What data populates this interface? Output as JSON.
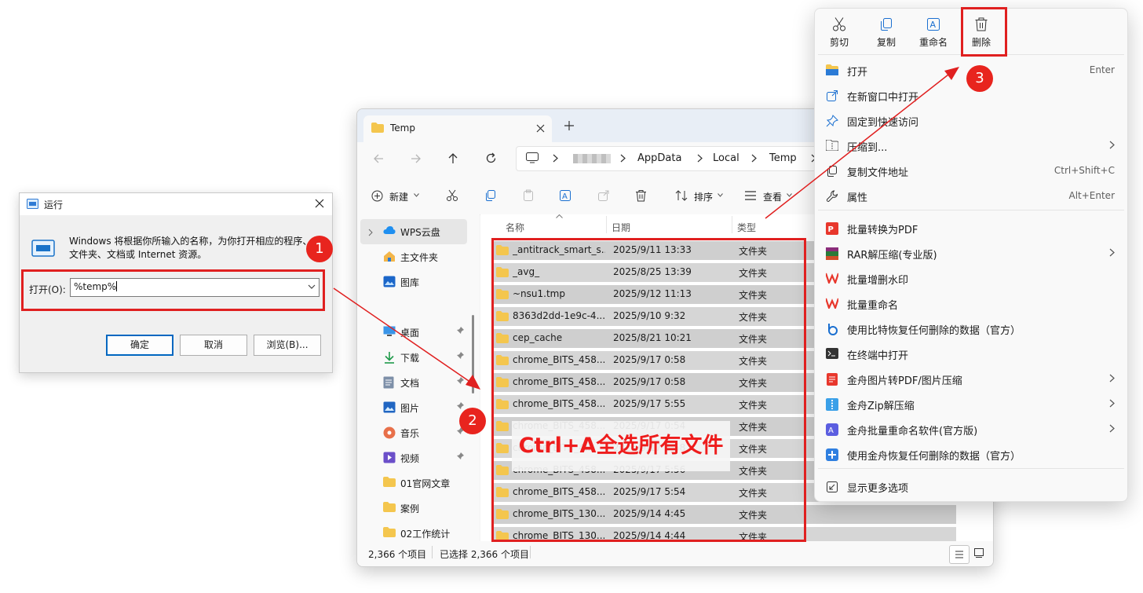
{
  "run_dialog": {
    "title": "运行",
    "description": "Windows 将根据你所输入的名称，为你打开相应的程序、文件夹、文档或 Internet 资源。",
    "open_label": "打开(O):",
    "input_value": "%temp%",
    "ok": "确定",
    "cancel": "取消",
    "browse": "浏览(B)..."
  },
  "explorer": {
    "tab_title": "Temp",
    "breadcrumb": [
      "AppData",
      "Local",
      "Temp"
    ],
    "toolbar": {
      "new": "新建",
      "sort": "排序",
      "view": "查看"
    },
    "nav": [
      {
        "label": "WPS云盘",
        "icon": "cloud-icon",
        "pinned": false
      },
      {
        "label": "主文件夹",
        "icon": "home-icon",
        "pinned": false
      },
      {
        "label": "图库",
        "icon": "gallery-icon",
        "pinned": false
      },
      {
        "label": "桌面",
        "icon": "desktop-icon",
        "pinned": true
      },
      {
        "label": "下载",
        "icon": "download-icon",
        "pinned": true
      },
      {
        "label": "文档",
        "icon": "document-icon",
        "pinned": true
      },
      {
        "label": "图片",
        "icon": "pictures-icon",
        "pinned": true
      },
      {
        "label": "音乐",
        "icon": "music-icon",
        "pinned": true
      },
      {
        "label": "视频",
        "icon": "video-icon",
        "pinned": true
      },
      {
        "label": "01官网文章",
        "icon": "folder-icon",
        "pinned": false
      },
      {
        "label": "案例",
        "icon": "folder-icon",
        "pinned": false
      },
      {
        "label": "02工作统计",
        "icon": "folder-icon",
        "pinned": false
      }
    ],
    "columns": {
      "name": "名称",
      "date": "日期",
      "type": "类型"
    },
    "files": [
      {
        "name": "_antitrack_smart_s...",
        "date": "2025/9/11 13:33",
        "type": "文件夹"
      },
      {
        "name": "_avg_",
        "date": "2025/8/25 13:39",
        "type": "文件夹"
      },
      {
        "name": "~nsu1.tmp",
        "date": "2025/9/12 11:13",
        "type": "文件夹"
      },
      {
        "name": "8363d2dd-1e9c-4...",
        "date": "2025/9/10 9:32",
        "type": "文件夹"
      },
      {
        "name": "cep_cache",
        "date": "2025/8/21 10:21",
        "type": "文件夹"
      },
      {
        "name": "chrome_BITS_458...",
        "date": "2025/9/17 0:58",
        "type": "文件夹"
      },
      {
        "name": "chrome_BITS_458...",
        "date": "2025/9/17 0:58",
        "type": "文件夹"
      },
      {
        "name": "chrome_BITS_458...",
        "date": "2025/9/17 5:55",
        "type": "文件夹"
      },
      {
        "name": "chrome_BITS_458...",
        "date": "2025/9/17 0:54",
        "type": "文件夹"
      },
      {
        "name": "chrome_BITS_4...",
        "date": "2025/9/17 5:58",
        "type": "文件夹"
      },
      {
        "name": "chrome_BITS_458...",
        "date": "2025/9/17 5:56",
        "type": "文件夹"
      },
      {
        "name": "chrome_BITS_458...",
        "date": "2025/9/17 5:54",
        "type": "文件夹"
      },
      {
        "name": "chrome_BITS_130...",
        "date": "2025/9/14 4:45",
        "type": "文件夹"
      },
      {
        "name": "chrome_BITS_130...",
        "date": "2025/9/14 4:44",
        "type": "文件夹"
      }
    ],
    "status_count": "2,366 个项目",
    "status_selected": "已选择 2,366 个项目"
  },
  "context_menu": {
    "quick_actions": [
      {
        "label": "剪切",
        "icon": "scissors-icon"
      },
      {
        "label": "复制",
        "icon": "copy-icon"
      },
      {
        "label": "重命名",
        "icon": "rename-icon"
      },
      {
        "label": "删除",
        "icon": "trash-icon"
      }
    ],
    "items": [
      {
        "label": "打开",
        "shortcut": "Enter",
        "icon": "folder-open-icon",
        "submenu": false
      },
      {
        "label": "在新窗口中打开",
        "shortcut": "",
        "icon": "new-window-icon",
        "submenu": false
      },
      {
        "label": "固定到快速访问",
        "shortcut": "",
        "icon": "pin-icon",
        "submenu": false
      },
      {
        "label": "压缩到...",
        "shortcut": "",
        "icon": "zip-icon",
        "submenu": true
      },
      {
        "label": "复制文件地址",
        "shortcut": "Ctrl+Shift+C",
        "icon": "copy-path-icon",
        "submenu": false
      },
      {
        "label": "属性",
        "shortcut": "Alt+Enter",
        "icon": "wrench-icon",
        "submenu": false
      },
      {
        "label": "批量转换为PDF",
        "shortcut": "",
        "icon": "pdf-icon",
        "submenu": false
      },
      {
        "label": "RAR解压缩(专业版)",
        "shortcut": "",
        "icon": "rar-icon",
        "submenu": true
      },
      {
        "label": "批量增删水印",
        "shortcut": "",
        "icon": "wps-icon",
        "submenu": false
      },
      {
        "label": "批量重命名",
        "shortcut": "",
        "icon": "wps-icon",
        "submenu": false
      },
      {
        "label": "使用比特恢复任何删除的数据（官方）",
        "shortcut": "",
        "icon": "bit-recovery-icon",
        "submenu": false
      },
      {
        "label": "在终端中打开",
        "shortcut": "",
        "icon": "terminal-icon",
        "submenu": false
      },
      {
        "label": "金舟图片转PDF/图片压缩",
        "shortcut": "",
        "icon": "jinzhou-pdf-icon",
        "submenu": true
      },
      {
        "label": "金舟Zip解压缩",
        "shortcut": "",
        "icon": "jinzhou-zip-icon",
        "submenu": true
      },
      {
        "label": "金舟批量重命名软件(官方版)",
        "shortcut": "",
        "icon": "jinzhou-rename-icon",
        "submenu": true
      },
      {
        "label": "使用金舟恢复任何删除的数据（官方）",
        "shortcut": "",
        "icon": "jinzhou-recovery-icon",
        "submenu": false
      },
      {
        "label": "显示更多选项",
        "shortcut": "",
        "icon": "more-options-icon",
        "submenu": false
      }
    ]
  },
  "annotations": {
    "step1": "1",
    "step2": "2",
    "step3": "3",
    "callout": "Ctrl+A全选所有文件"
  }
}
